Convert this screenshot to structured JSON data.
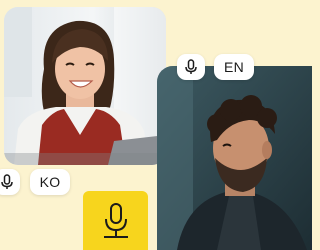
{
  "participants": [
    {
      "position": "left",
      "language_label": "KO",
      "mic_icon": "microphone-icon"
    },
    {
      "position": "right",
      "language_label": "EN",
      "mic_icon": "microphone-icon"
    }
  ],
  "mic_button": {
    "icon": "microphone-icon"
  },
  "colors": {
    "background": "#fcf3cf",
    "accent_yellow": "#f7d51d",
    "chip_background": "#ffffff",
    "text": "#1b1b1b"
  }
}
